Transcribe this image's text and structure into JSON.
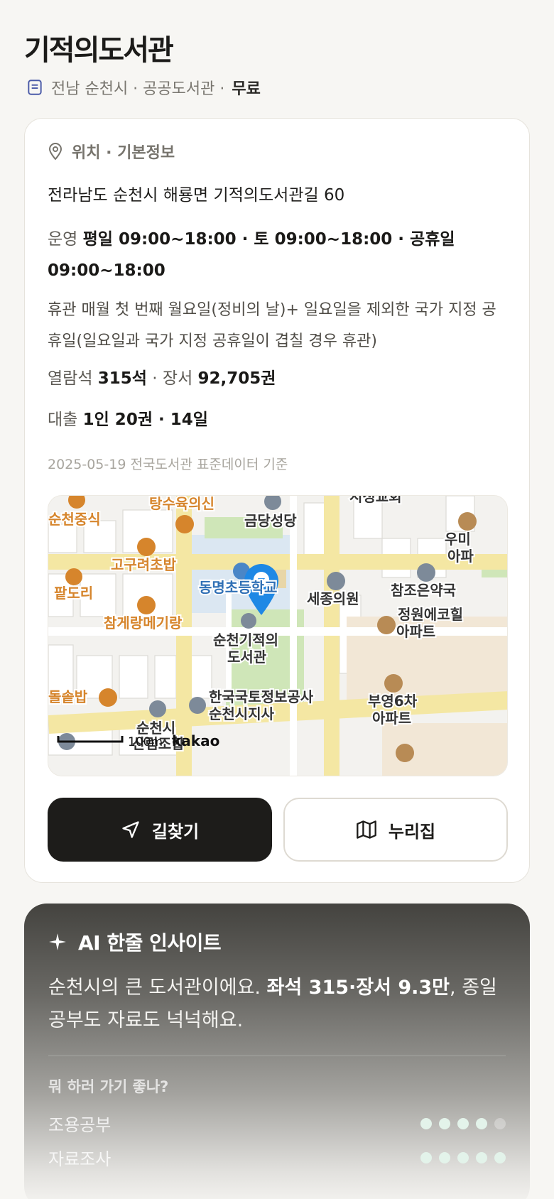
{
  "header": {
    "title": "기적의도서관",
    "meta": "전남 순천시 · 공공도서관 ·",
    "fee": "무료"
  },
  "info": {
    "section_label": "위치 · 기본정보",
    "address": "전라남도 순천시 해룡면 기적의도서관길 60",
    "hours_label": "운영",
    "hours_value": "평일 09:00~18:00 · 토 09:00~18:00 · 공휴일 09:00~18:00",
    "closed_label": "휴관",
    "closed_value": "매월 첫 번째 월요일(정비의 날)+ 일요일을 제외한 국가 지정 공휴일(일요일과 국가 지정 공휴일이 겹칠 경우 휴관)",
    "seats_label": "열람석",
    "seats_value": "315석",
    "books_label": "장서",
    "books_value": "92,705권",
    "loan_label": "대출",
    "loan_value": "1인 20권 · 14일",
    "basis": "2025-05-19 전국도서관 표준데이터 기준"
  },
  "map": {
    "labels": {
      "p1": "탕수육의신",
      "p2": "금당성당",
      "p3": "시청교회",
      "p4": "순천중식",
      "p5": "고구려초밥",
      "p6": "우미",
      "p7": "아파",
      "p8": "팥도리",
      "p9": "동명초등학교",
      "p10": "세종의원",
      "p11": "참조은약국",
      "p12": "참게랑메기랑",
      "p13": "정원에코힐",
      "p14": "아파트",
      "p15": "순천기적의",
      "p16": "도서관",
      "p17": "한국국토정보공사",
      "p18": "순천시지사",
      "p19": "부영6차",
      "p20": "아파트",
      "p21": "돌솥밥",
      "p22": "순천시",
      "p23": "산림조합"
    },
    "scale": "100m",
    "brand": "kakao"
  },
  "actions": {
    "directions": "길찾기",
    "nurizip": "누리집"
  },
  "ai": {
    "title": "AI 한줄 인사이트",
    "text_a": "순천시의 큰 도서관이에요. ",
    "text_b": "좌석 315·장서 9.3만",
    "text_c": ", 종일 공부도 자료도 넉넉해요.",
    "question": "뭐 하러 가기 좋나?",
    "rows": [
      {
        "label": "조용공부",
        "score": 4
      },
      {
        "label": "자료조사",
        "score": 5
      }
    ]
  },
  "colors": {
    "accent_blue": "#1e88e5",
    "food_orange": "#d6852c",
    "map_road": "#f4e7a3",
    "map_park": "#cfe6b8"
  }
}
